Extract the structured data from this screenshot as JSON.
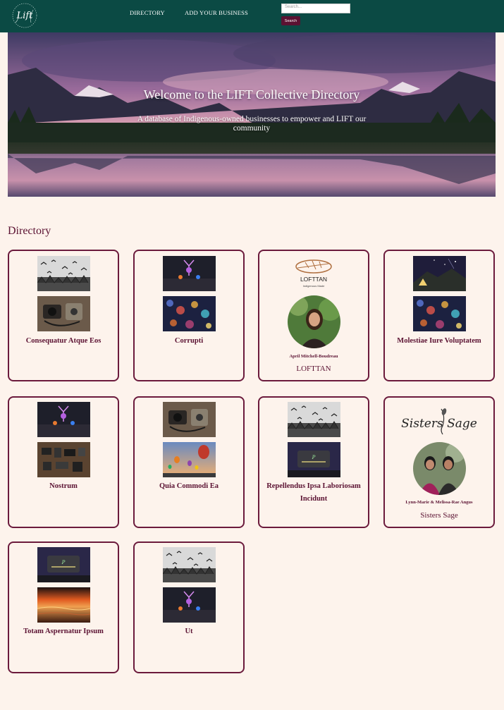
{
  "nav": {
    "logo_text": "Lift",
    "links": [
      "DIRECTORY",
      "ADD YOUR BUSINESS"
    ],
    "search_placeholder": "Search...",
    "search_button": "Search"
  },
  "hero": {
    "title": "Welcome to the LIFT Collective Directory",
    "subtitle": "A database of Indigenous-owned businesses to empower and LIFT our community"
  },
  "directory": {
    "heading": "Directory",
    "cards": [
      {
        "name": "Consequatur Atque Eos",
        "images": [
          "birds",
          "cameras"
        ]
      },
      {
        "name": "Corrupti",
        "images": [
          "neon-deer",
          "city-bokeh"
        ]
      },
      {
        "name": "LOFTTAN",
        "logo_text": "LOFTTAN",
        "logo_tagline": "Indigenous Made",
        "owner": "April Mitchell-Boudreau"
      },
      {
        "name": "Molestiae Iure Voluptatem",
        "images": [
          "night-tent",
          "city-bokeh"
        ]
      },
      {
        "name": "Nostrum",
        "images": [
          "neon-deer",
          "gear-flatlay"
        ]
      },
      {
        "name": "Quia Commodi Ea",
        "images": [
          "cameras",
          "balloons"
        ]
      },
      {
        "name": "Repellendus Ipsa Laboriosam Incidunt",
        "images": [
          "birds",
          "neon-sign"
        ]
      },
      {
        "name": "Sisters Sage",
        "logo_text": "Sisters Sage",
        "owner": "Lynn-Marie & Melissa-Rae Angus"
      },
      {
        "name": "Totam Aspernatur Ipsum",
        "images": [
          "neon-sign",
          "sunset-water"
        ]
      },
      {
        "name": "Ut",
        "images": [
          "birds",
          "neon-deer"
        ]
      }
    ]
  },
  "colors": {
    "nav_bg": "#0b4a44",
    "accent": "#5b1232",
    "page_bg": "#fdf3ec"
  }
}
